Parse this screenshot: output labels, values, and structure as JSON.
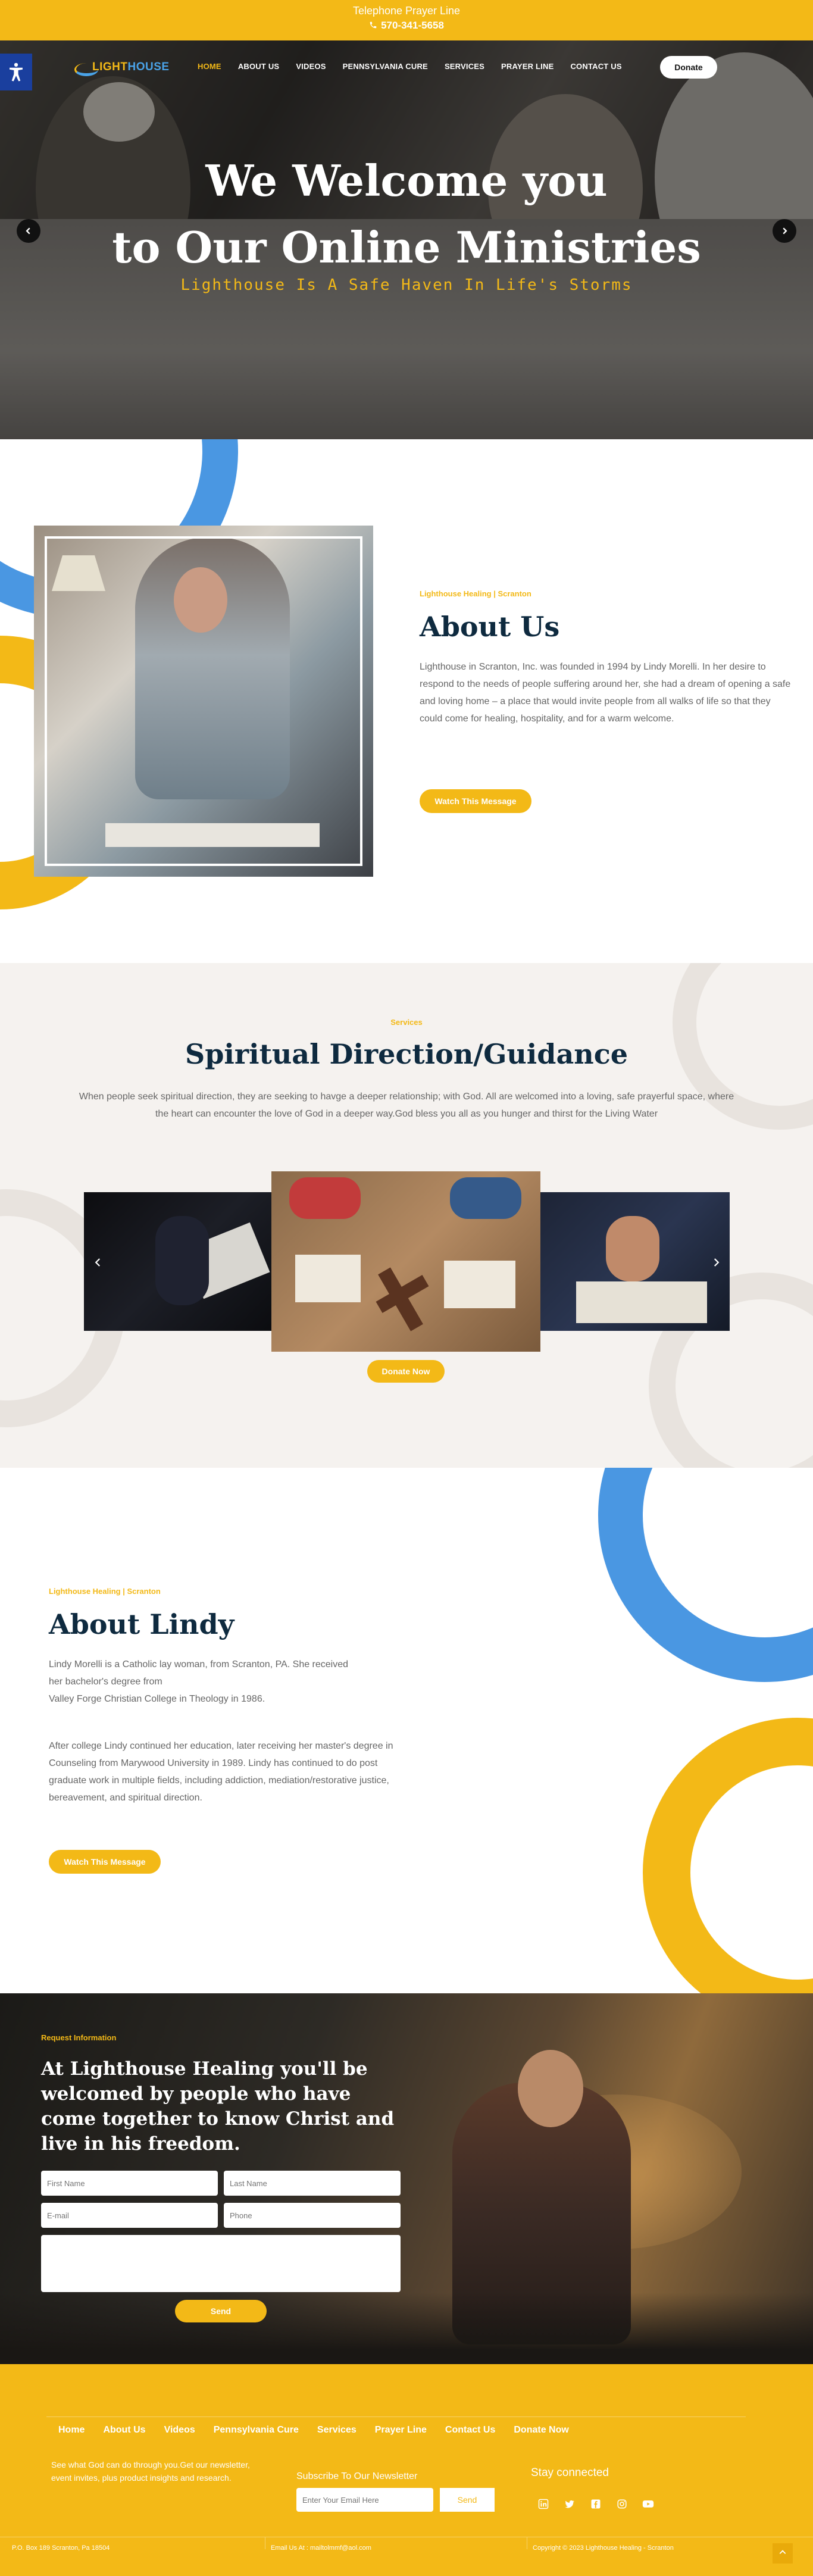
{
  "topbar": {
    "line1": "Telephone Prayer Line",
    "phone": "570-341-5658"
  },
  "nav": {
    "logo_text_a": "LIGHT",
    "logo_text_b": "HOUSE",
    "items": [
      {
        "label": "HOME",
        "active": true
      },
      {
        "label": "ABOUT US"
      },
      {
        "label": "VIDEOS"
      },
      {
        "label": "PENNSYLVANIA CURE"
      },
      {
        "label": "SERVICES"
      },
      {
        "label": "PRAYER LINE"
      },
      {
        "label": "CONTACT US"
      }
    ],
    "donate_label": "Donate"
  },
  "hero": {
    "title_line1": "We Welcome you",
    "title_line2": "to Our Online Ministries",
    "subtitle": "Lighthouse Is A Safe Haven In Life's Storms",
    "prev_icon": "chevron-left-icon",
    "next_icon": "chevron-right-icon"
  },
  "about": {
    "eyebrow": "Lighthouse Healing | Scranton",
    "title": "About Us",
    "body": "Lighthouse in Scranton, Inc. was founded in 1994 by Lindy Morelli. In her desire to respond to the needs of people suffering around her, she had a dream of opening a safe and loving home – a place that would invite people from all walks of life so that they could come for healing, hospitality, and for a warm welcome.",
    "button": "Watch This Message"
  },
  "services": {
    "eyebrow": "Services",
    "title": "Spiritual Direction/Guidance",
    "body": "When people seek spiritual direction, they are seeking to havge a deeper relationship; with God. All are welcomed into a loving, safe prayerful space, where the heart can encounter the love of God in a deeper way.God bless you all as you hunger and thirst for the Living Water",
    "button": "Donate Now"
  },
  "lindy": {
    "eyebrow": "Lighthouse Healing | Scranton",
    "title": "About Lindy",
    "p1_line1": "Lindy Morelli is a Catholic lay woman, from Scranton, PA. She received",
    "p1_line2": "her bachelor's degree from",
    "p1_line3": "Valley Forge Christian College in Theology in 1986.",
    "p2": "After college Lindy continued her education, later receiving her master's degree in Counseling from Marywood University in 1989. Lindy has continued to do post graduate work in multiple fields, including addiction, mediation/restorative justice, bereavement, and spiritual direction.",
    "button": "Watch This Message"
  },
  "request": {
    "eyebrow": "Request Information",
    "title": "At Lighthouse Healing you'll be welcomed by people who have come together to know Christ and live in his freedom.",
    "first_name": "First Name",
    "last_name": "Last Name",
    "email": "E-mail",
    "phone": "Phone",
    "send": "Send"
  },
  "footer": {
    "nav": [
      "Home",
      "About Us",
      "Videos",
      "Pennsylvania Cure",
      "Services",
      "Prayer Line",
      "Contact Us",
      "Donate Now"
    ],
    "blurb": "See what God can do through you.Get our newsletter, event invites, plus product insights and research.",
    "subscribe_title": "Subscribe To Our Newsletter",
    "email_placeholder": "Enter Your Email Here",
    "send": "Send",
    "stay_connected": "Stay connected",
    "social": [
      "linkedin-icon",
      "twitter-icon",
      "facebook-icon",
      "instagram-icon",
      "youtube-icon"
    ],
    "address": "P.O. Box 189 Scranton, Pa 18504",
    "email_line": "Email Us At : mailtolmmf@aol.com",
    "copyright": "Copyright © 2023 Lighthouse Healing - Scranton"
  },
  "colors": {
    "accent": "#f3b917",
    "blue": "#4a97e2",
    "heading": "#0e2a3f",
    "access_blue": "#1a3f9e"
  }
}
